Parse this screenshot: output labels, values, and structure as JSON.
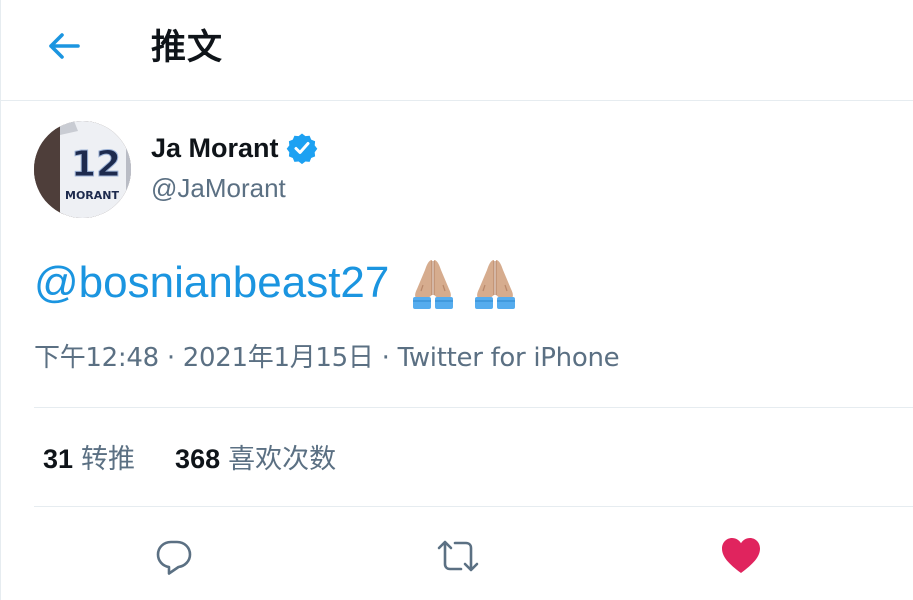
{
  "header": {
    "title": "推文",
    "back_icon": "arrow-left-icon"
  },
  "author": {
    "display_name": "Ja Morant",
    "handle": "@JaMorant",
    "verified_icon": "verified-badge-icon",
    "avatar_jersey_number": "12",
    "avatar_jersey_name": "MORANT"
  },
  "tweet": {
    "mention": "@bosnianbeast27",
    "emojis": [
      "folded-hands-emoji",
      "folded-hands-emoji"
    ]
  },
  "meta": {
    "time": "下午12:48",
    "separator": "·",
    "date": "2021年1月15日",
    "source": "Twitter for iPhone"
  },
  "stats": {
    "retweets_count": "31",
    "retweets_label": "转推",
    "likes_count": "368",
    "likes_label": "喜欢次数"
  },
  "actions": {
    "reply_icon": "reply-icon",
    "retweet_icon": "retweet-icon",
    "like_icon": "heart-filled-icon"
  },
  "colors": {
    "accent": "#1b95e0",
    "secondary_text": "#5b7083",
    "like": "#e0245e",
    "divider": "#e6ecf0"
  }
}
